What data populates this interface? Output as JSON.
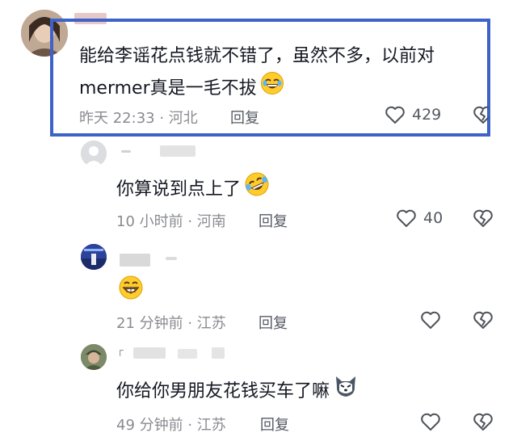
{
  "colors": {
    "highlight_border": "#3d63c9",
    "text_primary": "#161823",
    "text_meta": "#8a8b91",
    "icon": "#4e525a"
  },
  "comments": [
    {
      "text_line1": "能给李谣花点钱就不错了，虽然不多，以前对",
      "text_line2": "mermer真是一毛不拔",
      "emoji": "laughing-emoji",
      "time_location": "昨天 22:33 · 河北",
      "reply_label": "回复",
      "likes": "429",
      "highlighted": true
    },
    {
      "text": "你算说到点上了",
      "emoji": "rolling-laughing-emoji",
      "time_location": "10 小时前 · 河南",
      "reply_label": "回复",
      "likes": "40"
    },
    {
      "text": "",
      "emoji": "grinning-emoji",
      "time_location": "21 分钟前 · 江苏",
      "reply_label": "回复",
      "likes": ""
    },
    {
      "username_visible": "⸀",
      "text": "你给你男朋友花钱买车了嘛",
      "emoji": "husky-emoji",
      "time_location": "49 分钟前 · 江苏",
      "reply_label": "回复",
      "likes": ""
    }
  ]
}
